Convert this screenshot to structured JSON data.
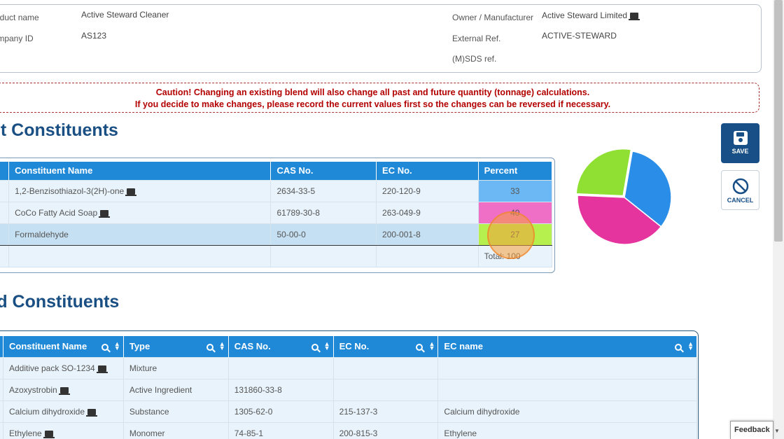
{
  "product": {
    "name_label": "Product name",
    "name_value": "Active Steward Cleaner",
    "company_id_label": "Company ID",
    "company_id_value": "AS123",
    "owner_label": "Owner / Manufacturer",
    "owner_value": "Active Steward Limited",
    "external_ref_label": "External Ref.",
    "external_ref_value": "ACTIVE-STEWARD",
    "msds_label": "(M)SDS ref."
  },
  "caution": {
    "line1": "Caution! Changing an existing blend will also change all past and future quantity (tonnage) calculations.",
    "line2": "If you decide to make changes, please record the current values first so the changes can be reversed if necessary."
  },
  "edit_section": {
    "title": "Edit Constituents",
    "columns": [
      "Constituent Name",
      "CAS No.",
      "EC No.",
      "Percent"
    ],
    "rows": [
      {
        "name": "1,2-Benzisothiazol-3(2H)-one",
        "cas": "2634-33-5",
        "ec": "220-120-9",
        "percent": "33",
        "color": "#6bb8f5"
      },
      {
        "name": "CoCo Fatty Acid Soap",
        "cas": "61789-30-8",
        "ec": "263-049-9",
        "percent": "40",
        "color": "#f06fc6"
      },
      {
        "name": "Formaldehyde",
        "cas": "50-00-0",
        "ec": "200-001-8",
        "percent": "27",
        "color": "#b5f04e"
      }
    ],
    "total": "Total: 100"
  },
  "pie_colors": [
    "#2a8ee8",
    "#e6349f",
    "#8fe033"
  ],
  "buttons": {
    "save": "SAVE",
    "cancel": "CANCEL"
  },
  "add_section": {
    "title": "Add Constituents",
    "columns": [
      "Constituent Name",
      "Type",
      "CAS No.",
      "EC No.",
      "EC name"
    ],
    "rows": [
      {
        "name": "Additive pack SO-1234",
        "type": "Mixture",
        "cas": "",
        "ec": "",
        "ec_name": ""
      },
      {
        "name": "Azoxystrobin",
        "type": "Active Ingredient",
        "cas": "131860-33-8",
        "ec": "",
        "ec_name": ""
      },
      {
        "name": "Calcium dihydroxide",
        "type": "Substance",
        "cas": "1305-62-0",
        "ec": "215-137-3",
        "ec_name": "Calcium dihydroxide"
      },
      {
        "name": "Ethylene",
        "type": "Monomer",
        "cas": "74-85-1",
        "ec": "200-815-3",
        "ec_name": "Ethylene"
      }
    ]
  },
  "feedback_label": "Feedback"
}
